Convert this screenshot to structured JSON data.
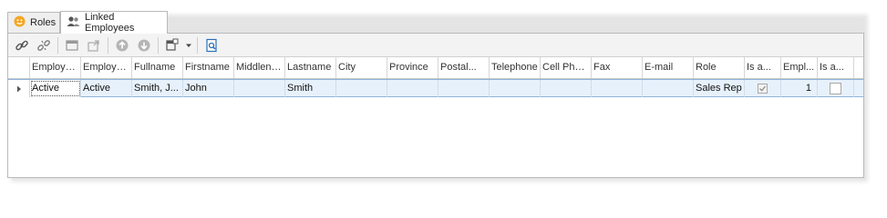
{
  "tabs": [
    {
      "label": "Roles",
      "icon": "roles-mask-icon"
    },
    {
      "label": "Linked Employees",
      "icon": "employees-icon"
    }
  ],
  "toolbar": {
    "items": [
      "link-icon",
      "unlink-icon",
      "layout-icon",
      "export-icon",
      "move-up-icon",
      "move-down-icon",
      "column-chooser-icon",
      "dropdown-arrow-icon",
      "preview-icon"
    ]
  },
  "grid": {
    "columns": [
      {
        "label": "Employe..."
      },
      {
        "label": "Employe..."
      },
      {
        "label": "Fullname"
      },
      {
        "label": "Firstname"
      },
      {
        "label": "Middlenam"
      },
      {
        "label": "Lastname"
      },
      {
        "label": "City"
      },
      {
        "label": "Province"
      },
      {
        "label": "Postal..."
      },
      {
        "label": "Telephone"
      },
      {
        "label": "Cell Phone"
      },
      {
        "label": "Fax"
      },
      {
        "label": "E-mail"
      },
      {
        "label": "Role"
      },
      {
        "label": "Is a..."
      },
      {
        "label": "Empl..."
      },
      {
        "label": "Is a..."
      }
    ],
    "rows": [
      {
        "status1": "Active",
        "status2": "Active",
        "fullname": "Smith, J...",
        "firstname": "John",
        "middlename": "",
        "lastname": "Smith",
        "city": "",
        "province": "",
        "postal": "",
        "telephone": "",
        "cellphone": "",
        "fax": "",
        "email": "",
        "role": "Sales Rep",
        "is_a_1": true,
        "empl": "1",
        "is_a_2": false
      }
    ]
  },
  "colors": {
    "selected_row": "#e7f1fb",
    "border": "#b9b9b9",
    "toolbar_bg": "#f3f3f3",
    "tab_icon_orange": "#f5a623"
  }
}
